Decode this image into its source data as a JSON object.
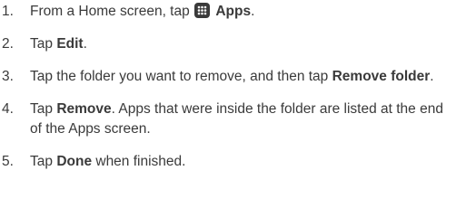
{
  "steps": [
    {
      "number": "1.",
      "text_before": "From a Home screen, tap ",
      "icon": "apps-grid-icon",
      "bold": "Apps",
      "text_after": "."
    },
    {
      "number": "2.",
      "text_before": "Tap ",
      "bold": "Edit",
      "text_after": "."
    },
    {
      "number": "3.",
      "text_before": "Tap the folder you want to remove, and then tap ",
      "bold": "Remove folder",
      "text_after": "."
    },
    {
      "number": "4.",
      "text_before": "Tap ",
      "bold": "Remove",
      "text_after": ". Apps that were inside the folder are listed at the end of the Apps screen."
    },
    {
      "number": "5.",
      "text_before": "Tap ",
      "bold": "Done",
      "text_after": " when finished."
    }
  ],
  "colors": {
    "text": "#3a3a3a",
    "icon_bg": "#3a3a3a",
    "icon_fg": "#ffffff"
  }
}
